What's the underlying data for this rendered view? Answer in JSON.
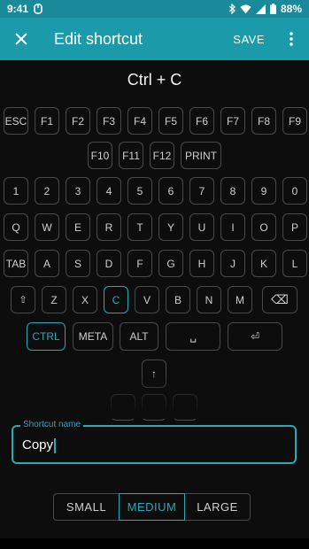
{
  "status_bar": {
    "time": "9:41",
    "battery": "88%"
  },
  "app_bar": {
    "title": "Edit shortcut",
    "save_label": "SAVE"
  },
  "shortcut_display": "Ctrl + C",
  "keyboard": {
    "rows": [
      [
        "ESC",
        "F1",
        "F2",
        "F3",
        "F4",
        "F5",
        "F6",
        "F7",
        "F8",
        "F9"
      ],
      [
        "F10",
        "F11",
        "F12",
        "PRINT"
      ],
      [
        "1",
        "2",
        "3",
        "4",
        "5",
        "6",
        "7",
        "8",
        "9",
        "0"
      ],
      [
        "Q",
        "W",
        "E",
        "R",
        "T",
        "Y",
        "U",
        "I",
        "O",
        "P"
      ],
      [
        "TAB",
        "A",
        "S",
        "D",
        "F",
        "G",
        "H",
        "J",
        "K",
        "L"
      ],
      [
        "⇧",
        "Z",
        "X",
        "C",
        "V",
        "B",
        "N",
        "M",
        "⌫"
      ],
      [
        "CTRL",
        "META",
        "ALT",
        "␣",
        "⏎"
      ],
      [
        "↑"
      ]
    ],
    "selected_keys": [
      "C",
      "CTRL"
    ]
  },
  "shortcut_name": {
    "label": "Shortcut name",
    "value": "Copy"
  },
  "size_options": {
    "items": [
      "SMALL",
      "MEDIUM",
      "LARGE"
    ],
    "selected": "MEDIUM"
  },
  "colors": {
    "accent": "#2aa8b8",
    "app_bar": "#1b9aaa",
    "status_bar": "#1a8a9a",
    "background": "#0d0d0d"
  }
}
